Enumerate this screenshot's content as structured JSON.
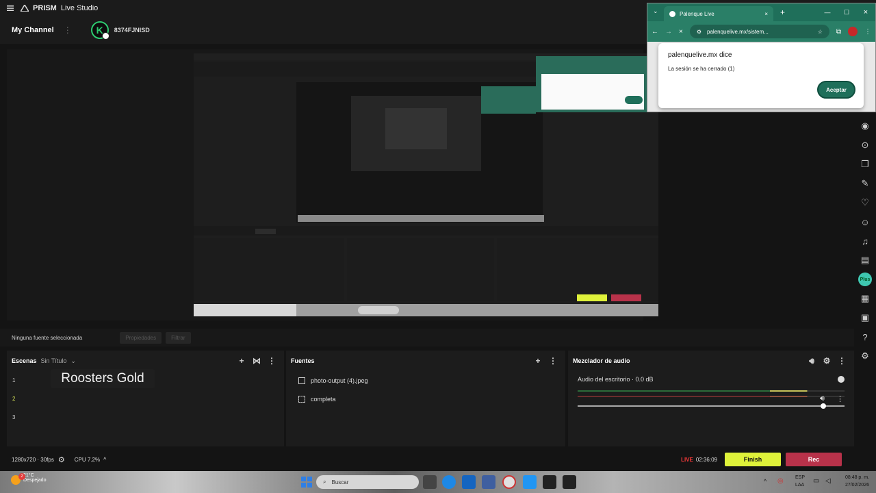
{
  "app": {
    "title": "PRISM",
    "title_suffix": "Live Studio"
  },
  "channel": {
    "label": "My Channel",
    "id": "8374FJNISD"
  },
  "source_bar": {
    "no_source": "Ninguna fuente seleccionada",
    "properties": "Propiedades",
    "filters": "Filtrar"
  },
  "scenes": {
    "title": "Escenas",
    "subtitle": "Sin Título",
    "items": [
      "1",
      "2",
      "3"
    ],
    "tooltip": "Roosters Gold"
  },
  "sources": {
    "title": "Fuentes",
    "items": [
      {
        "label": "photo-output (4).jpeg",
        "icon": "image-icon"
      },
      {
        "label": "completa",
        "icon": "fullscreen-icon"
      }
    ]
  },
  "mixer": {
    "title": "Mezclador de audio",
    "channel": "Audio del escritorio · 0.0 dB",
    "volume": 0.92
  },
  "status": {
    "resolution": "1280x720 · 30fps",
    "cpu": "CPU 7.2%",
    "live_label": "LIVE",
    "live_time": "02:36:09",
    "finish": "Finish",
    "rec": "Rec"
  },
  "right_toolbar": {
    "plus_badge": "Plus"
  },
  "browser": {
    "tab_title": "Palenque Live",
    "url": "palenquelive.mx/sistem...",
    "dialog_title": "palenquelive.mx dice",
    "dialog_message": "La sesión se ha cerrado (1)",
    "dialog_button": "Aceptar"
  },
  "taskbar": {
    "search_placeholder": "Buscar",
    "weather_temp": "21°C",
    "weather_desc": "Despejado",
    "weather_badge": "2",
    "lang1": "ESP",
    "lang2": "LAA",
    "time": "08:48 p. m.",
    "date": "27/02/2026"
  },
  "colors": {
    "finish": "#dff23a",
    "rec": "#b8324a",
    "live": "#ff3b3b",
    "chrome": "#1f6f5a"
  }
}
